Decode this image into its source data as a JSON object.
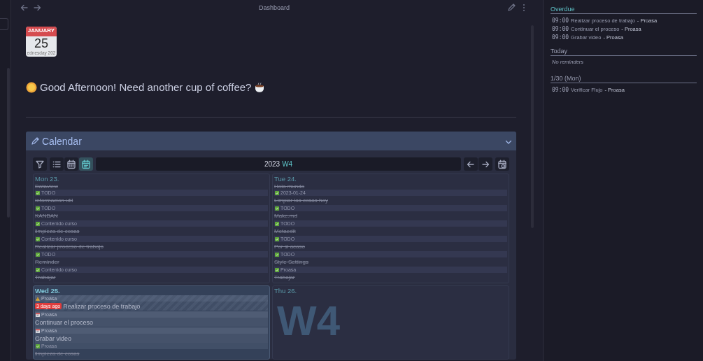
{
  "nav": {
    "title": "Dashboard"
  },
  "date_badge": {
    "month": "JANUARY",
    "day": "25",
    "weekday": "ednesday 202"
  },
  "greeting": "Good Afternoon! Need another cup of coffee?",
  "calendar": {
    "title": "Calendar",
    "expanded": true,
    "views": [
      {
        "kind": "list",
        "selected": false
      },
      {
        "kind": "month",
        "selected": false
      },
      {
        "kind": "week",
        "selected": true
      }
    ],
    "period_year": "2023",
    "period_week": "W4",
    "watermark": "W4",
    "days": [
      {
        "label": "Mon 23.",
        "today": false,
        "items": [
          {
            "kind": "done",
            "title": "Dataview"
          },
          {
            "kind": "done",
            "tag": "TODO",
            "title": "Informacion util"
          },
          {
            "kind": "done",
            "tag": "TODO",
            "title": "KANBAN"
          },
          {
            "kind": "done",
            "tag": "Contenido curso",
            "title": "limpieza de cosas"
          },
          {
            "kind": "done",
            "tag": "Contenido curso",
            "title": "Realizar proceso de trabajo"
          },
          {
            "kind": "done",
            "tag": "TODO",
            "title": "Reminder"
          },
          {
            "kind": "done",
            "tag": "Contenido curso",
            "title": "Trabajar"
          }
        ]
      },
      {
        "label": "Tue 24.",
        "today": false,
        "items": [
          {
            "kind": "done",
            "title": "Hola mundo"
          },
          {
            "kind": "done",
            "tag": "2023-01-24",
            "title": "Limpiar las cosas hoy"
          },
          {
            "kind": "done",
            "tag": "TODO",
            "title": "Make.md"
          },
          {
            "kind": "done",
            "tag": "TODO",
            "title": "Metaedit"
          },
          {
            "kind": "done",
            "tag": "TODO",
            "title": "Por si acaso"
          },
          {
            "kind": "done",
            "tag": "TODO",
            "title": "Style Settings"
          },
          {
            "kind": "done",
            "tag": "Proasa",
            "title": "Trabajar"
          }
        ]
      },
      {
        "label": "Wed 25.",
        "today": true,
        "items": [
          {
            "kind": "overdue",
            "tag": "Proasa",
            "badge": "3 days ago",
            "title": "Realizar proceso de trabajo"
          },
          {
            "kind": "scheduled",
            "tag": "Proasa",
            "title": "Continuar el proceso"
          },
          {
            "kind": "scheduled",
            "tag": "Proasa",
            "title": "Grabar video"
          },
          {
            "kind": "done",
            "tag": "Proasa",
            "title": "limpieza de cosas"
          }
        ]
      },
      {
        "label": "Thu 26.",
        "today": false
      }
    ]
  },
  "reminders": [
    {
      "title": "Overdue",
      "overdue": true,
      "items": [
        {
          "time": "09:00",
          "title": "Realizar proceso de trabajo",
          "file": "- Proasa"
        },
        {
          "time": "09:00",
          "title": "Continuar el proceso",
          "file": "- Proasa"
        },
        {
          "time": "09:00",
          "title": "Grabar video",
          "file": "- Proasa"
        }
      ]
    },
    {
      "title": "Today",
      "overdue": false,
      "empty_text": "No reminders"
    },
    {
      "title": "1/30 (Mon)",
      "overdue": false,
      "items": [
        {
          "time": "09:00",
          "title": "Verificar Flujo",
          "file": "- Proasa"
        }
      ]
    }
  ]
}
